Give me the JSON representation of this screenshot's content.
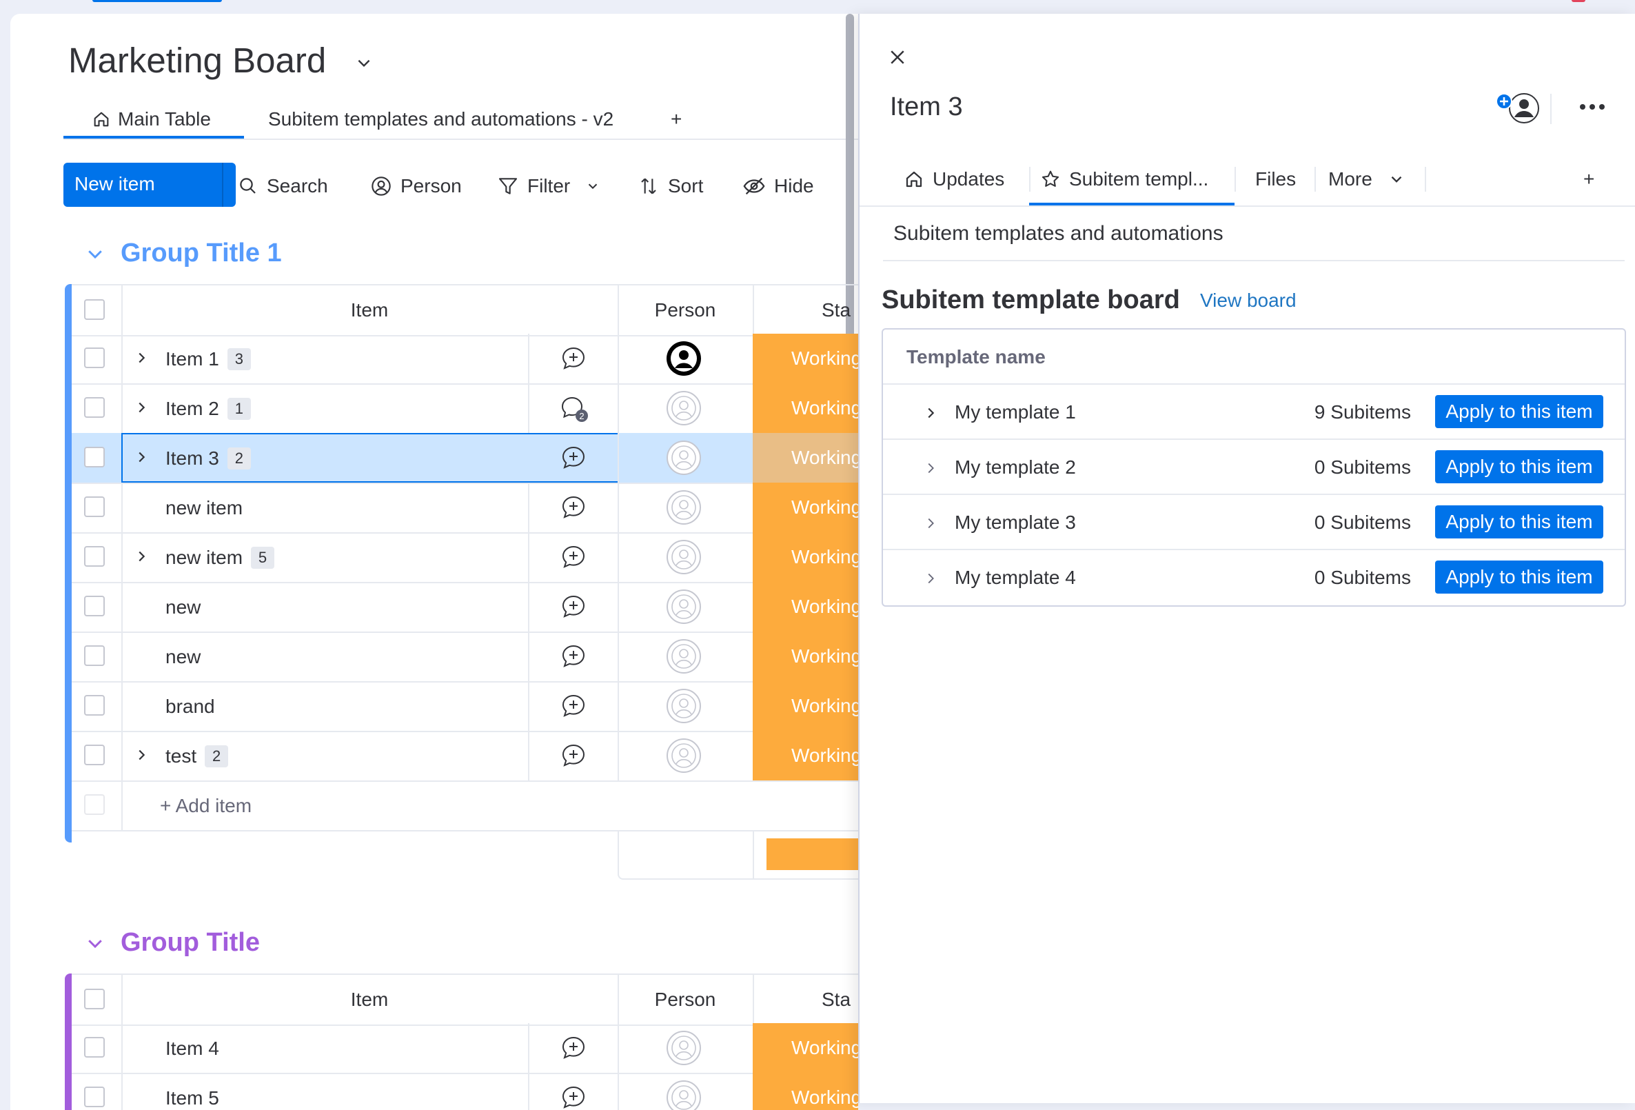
{
  "board": {
    "title": "Marketing Board",
    "views": [
      {
        "label": "Main Table"
      },
      {
        "label": "Subitem templates and automations - v2"
      },
      {
        "label": "+"
      }
    ],
    "toolbar": {
      "new_item": "New item",
      "search": "Search",
      "person": "Person",
      "filter": "Filter",
      "sort": "Sort",
      "hide": "Hide"
    }
  },
  "groups": [
    {
      "title": "Group Title 1",
      "color": "#579bfc",
      "columns": {
        "item": "Item",
        "person": "Person",
        "status": "Sta"
      },
      "rows": [
        {
          "name": "Item 1",
          "subitems": "3",
          "expandable": true,
          "status": "Working on it",
          "person": "assigned",
          "updates": ""
        },
        {
          "name": "Item 2",
          "subitems": "1",
          "expandable": true,
          "status": "Working on it",
          "person": "empty",
          "updates": "2"
        },
        {
          "name": "Item 3",
          "subitems": "2",
          "expandable": true,
          "status": "Working on it",
          "person": "empty",
          "updates": "",
          "selected": true
        },
        {
          "name": "new item",
          "subitems": "",
          "expandable": false,
          "status": "Working on it",
          "person": "empty",
          "updates": ""
        },
        {
          "name": "new item",
          "subitems": "5",
          "expandable": true,
          "status": "Working on it",
          "person": "empty",
          "updates": ""
        },
        {
          "name": "new",
          "subitems": "",
          "expandable": false,
          "status": "Working on it",
          "person": "empty",
          "updates": ""
        },
        {
          "name": "new",
          "subitems": "",
          "expandable": false,
          "status": "Working on it",
          "person": "empty",
          "updates": ""
        },
        {
          "name": "brand",
          "subitems": "",
          "expandable": false,
          "status": "Working on it",
          "person": "empty",
          "updates": ""
        },
        {
          "name": "test",
          "subitems": "2",
          "expandable": true,
          "status": "Working on it",
          "person": "empty",
          "updates": ""
        }
      ],
      "add_item": "+ Add item"
    },
    {
      "title": "Group Title",
      "color": "#a25ddc",
      "columns": {
        "item": "Item",
        "person": "Person",
        "status": "Sta"
      },
      "rows": [
        {
          "name": "Item 4",
          "subitems": "",
          "expandable": false,
          "status": "Working on it",
          "person": "empty",
          "updates": ""
        },
        {
          "name": "Item 5",
          "subitems": "",
          "expandable": false,
          "status": "Working on it",
          "person": "empty",
          "updates": ""
        }
      ]
    }
  ],
  "panel": {
    "item_title": "Item 3",
    "tabs": [
      {
        "label": "Updates",
        "icon": "home-icon"
      },
      {
        "label": "Subitem templ...",
        "icon": "star-icon",
        "active": true
      },
      {
        "label": "Files"
      },
      {
        "label": "More",
        "icon": "chevron-down-icon"
      },
      {
        "label": "+"
      }
    ],
    "section_title": "Subitem templates and automations",
    "template_board_title": "Subitem template board",
    "view_board": "View board",
    "table_header": "Template name",
    "templates": [
      {
        "name": "My template 1",
        "count": "9 Subitems",
        "action": "Apply to this item"
      },
      {
        "name": "My template 2",
        "count": "0 Subitems",
        "action": "Apply to this item"
      },
      {
        "name": "My template 3",
        "count": "0 Subitems",
        "action": "Apply to this item"
      },
      {
        "name": "My template 4",
        "count": "0 Subitems",
        "action": "Apply to this item"
      }
    ]
  },
  "colors": {
    "accent": "#0073ea",
    "status_working": "#fdab3d",
    "selected_row": "#cce5ff",
    "link": "#1f76c2"
  }
}
